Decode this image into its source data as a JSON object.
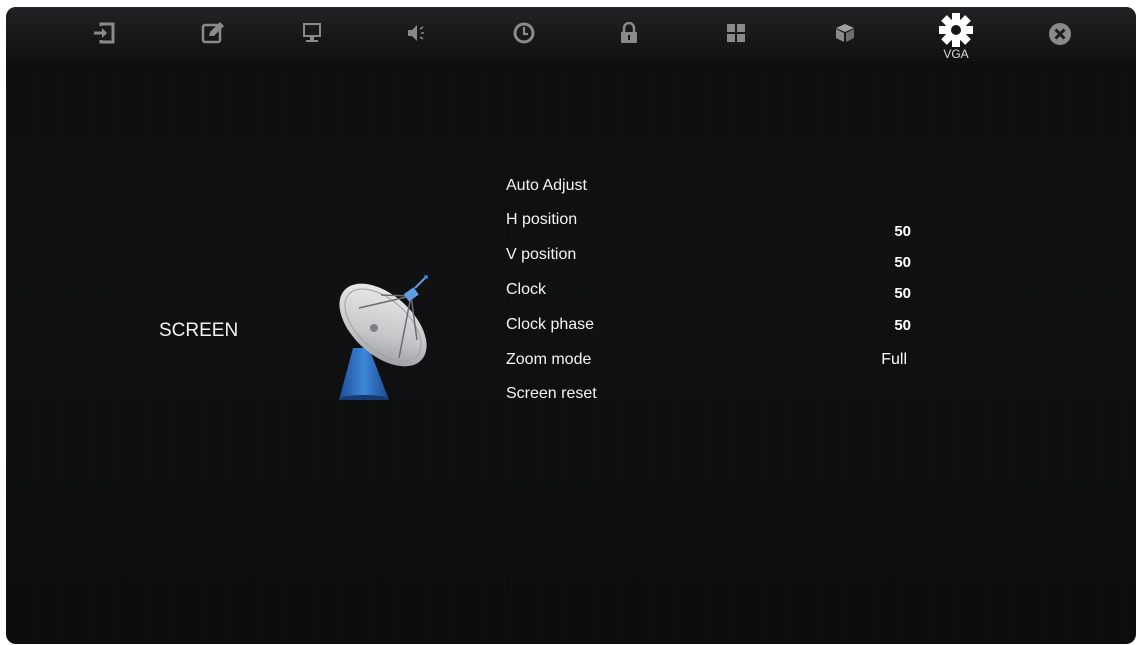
{
  "topbar": {
    "tabs": [
      {
        "icon": "input-source-icon"
      },
      {
        "icon": "edit-icon"
      },
      {
        "icon": "monitor-icon"
      },
      {
        "icon": "speaker-icon"
      },
      {
        "icon": "clock-icon"
      },
      {
        "icon": "lock-icon"
      },
      {
        "icon": "grid-icon"
      },
      {
        "icon": "cube-icon"
      },
      {
        "icon": "gear-icon",
        "label": "VGA",
        "active": true
      },
      {
        "icon": "close-icon"
      }
    ]
  },
  "section": {
    "title": "SCREEN",
    "icon": "satellite-dish-icon"
  },
  "menu": {
    "items": [
      {
        "label": "Auto Adjust",
        "value": ""
      },
      {
        "label": "H position",
        "value": "50"
      },
      {
        "label": "V position",
        "value": "50"
      },
      {
        "label": "Clock",
        "value": "50"
      },
      {
        "label": "Clock phase",
        "value": "50"
      },
      {
        "label": "Zoom mode",
        "value": "Full"
      },
      {
        "label": "Screen reset",
        "value": ""
      }
    ]
  },
  "colors": {
    "background": "#0e0f10",
    "text": "#ffffff",
    "icon_inactive": "#8a8a8a",
    "icon_active": "#ffffff",
    "dish_base": "#2f6fc0"
  }
}
